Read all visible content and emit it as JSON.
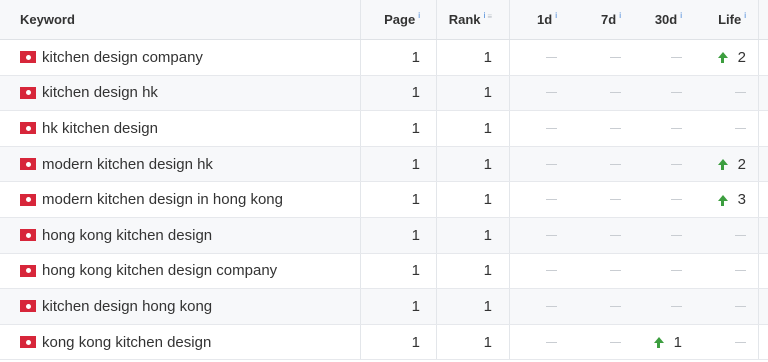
{
  "columns": {
    "keyword": "Keyword",
    "page": "Page",
    "rank": "Rank",
    "d1": "1d",
    "d7": "7d",
    "d30": "30d",
    "life": "Life"
  },
  "rows": [
    {
      "keyword": "kitchen design company",
      "page": "1",
      "rank": "1",
      "d30": "",
      "life": "2"
    },
    {
      "keyword": "kitchen design hk",
      "page": "1",
      "rank": "1",
      "d30": "",
      "life": ""
    },
    {
      "keyword": "hk kitchen design",
      "page": "1",
      "rank": "1",
      "d30": "",
      "life": ""
    },
    {
      "keyword": "modern kitchen design hk",
      "page": "1",
      "rank": "1",
      "d30": "",
      "life": "2"
    },
    {
      "keyword": "modern kitchen design in hong kong",
      "page": "1",
      "rank": "1",
      "d30": "",
      "life": "3"
    },
    {
      "keyword": "hong kong kitchen design",
      "page": "1",
      "rank": "1",
      "d30": "",
      "life": ""
    },
    {
      "keyword": "hong kong kitchen design company",
      "page": "1",
      "rank": "1",
      "d30": "",
      "life": ""
    },
    {
      "keyword": "kitchen design hong kong",
      "page": "1",
      "rank": "1",
      "d30": "",
      "life": ""
    },
    {
      "keyword": "kong kong kitchen design",
      "page": "1",
      "rank": "1",
      "d30": "1",
      "life": ""
    }
  ]
}
